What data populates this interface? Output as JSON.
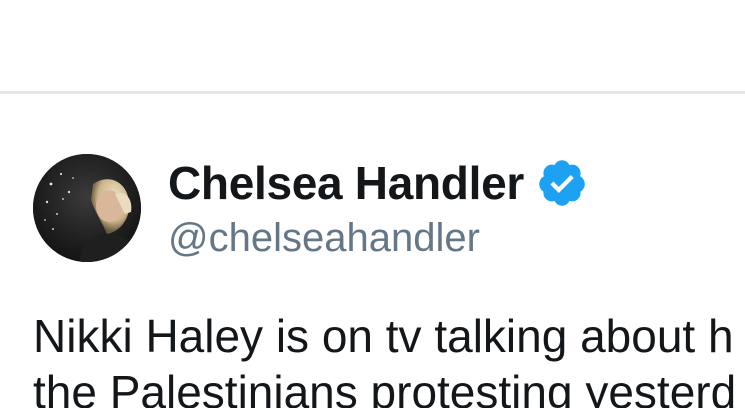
{
  "tweet": {
    "author": {
      "display_name": "Chelsea Handler",
      "handle": "@chelseahandler",
      "verified": true
    },
    "text_lines": [
      "Nikki Haley is on tv talking about h",
      "the Palestinians protesting yesterd"
    ]
  },
  "colors": {
    "name": "#14171a",
    "handle": "#657786",
    "verified_badge": "#1da1f2",
    "divider": "#e1e8ed"
  },
  "icons": {
    "verified": "verified-badge-icon",
    "avatar": "profile-photo"
  }
}
